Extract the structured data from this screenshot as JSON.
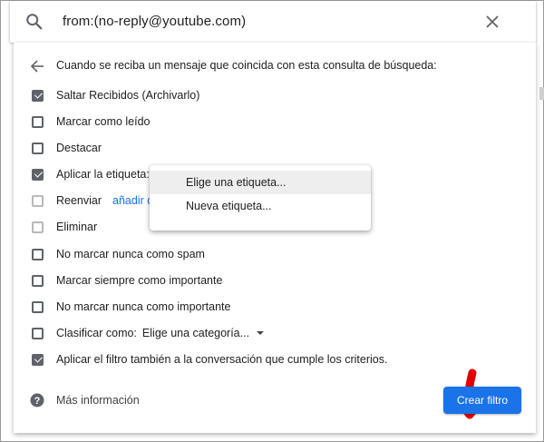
{
  "search": {
    "query": "from:(no-reply@youtube.com)",
    "search_icon": "search-icon",
    "close_icon": "close-icon"
  },
  "dialog": {
    "header": "Cuando se reciba un mensaje que coincida con esta consulta de búsqueda:",
    "back_icon": "arrow-back-icon",
    "options": [
      {
        "label": "Saltar Recibidos (Archivarlo)",
        "checked": true
      },
      {
        "label": "Marcar como leído",
        "checked": false
      },
      {
        "label": "Destacar",
        "checked": false
      },
      {
        "label": "Aplicar la etiqueta:",
        "checked": true
      },
      {
        "label": "Reenviar",
        "checked": false,
        "link": "añadir di"
      },
      {
        "label": "Eliminar",
        "checked": false
      },
      {
        "label": "No marcar nunca como spam",
        "checked": false
      },
      {
        "label": "Marcar siempre como importante",
        "checked": false
      },
      {
        "label": "No marcar nunca como importante",
        "checked": false
      },
      {
        "label": "Clasificar como:",
        "checked": false,
        "select": "Elige una categoría..."
      },
      {
        "label": "Aplicar el filtro también a la conversación que cumple los criterios.",
        "checked": true
      }
    ],
    "label_menu": {
      "items": [
        "Elige una etiqueta...",
        "Nueva etiqueta..."
      ]
    },
    "help_label": "Más información",
    "help_icon": "help-circle-icon",
    "create_button": "Crear filtro",
    "annotation_icon": "red-down-arrow-icon"
  },
  "colors": {
    "primary": "#1a73e8",
    "checkbox": "#5f6368",
    "annotation": "#e00000"
  }
}
